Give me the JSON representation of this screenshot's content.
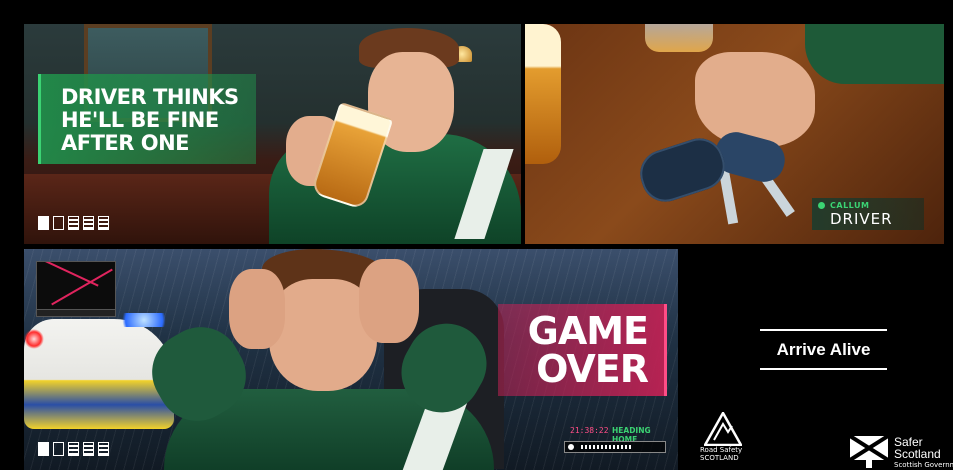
{
  "panel_top_left": {
    "headline_lines": [
      "DRIVER THINKS",
      "HE'LL BE FINE",
      "AFTER ONE"
    ],
    "status_icons": [
      "glass-full-icon",
      "glass-empty-icon",
      "slot-icon",
      "slot-icon",
      "slot-icon"
    ]
  },
  "panel_top_right": {
    "player_name": "CALLUM",
    "player_role": "DRIVER"
  },
  "panel_bottom": {
    "headline_lines": [
      "GAME",
      "OVER"
    ],
    "time": "21:38:22",
    "destination": "HEADING HOME",
    "progress": 0.65,
    "status_icons": [
      "glass-full-icon",
      "glass-empty-icon",
      "slot-icon",
      "slot-icon",
      "slot-icon"
    ]
  },
  "campaign": {
    "slogan": "Arrive Alive"
  },
  "logos": {
    "road_safety": [
      "Road Safety",
      "SCOTLAND"
    ],
    "safer_scotland": [
      "Safer",
      "Scotland",
      "Scottish",
      "Government"
    ]
  },
  "colors": {
    "accent_green": "#3bd373",
    "accent_pink": "#ff4d86",
    "banner_green": "#218c4a",
    "banner_pink": "#be2254"
  }
}
